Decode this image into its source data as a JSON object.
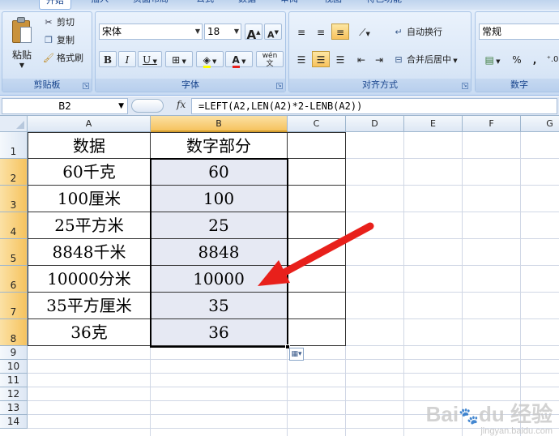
{
  "ribbon": {
    "tabs": [
      "开始",
      "插入",
      "页面布局",
      "公式",
      "数据",
      "审阅",
      "视图",
      "特色功能"
    ],
    "clipboard": {
      "paste": "粘贴",
      "cut": "剪切",
      "copy": "复制",
      "format_painter": "格式刷",
      "label": "剪贴板"
    },
    "font": {
      "name": "宋体",
      "size": "18",
      "grow": "A",
      "shrink": "A",
      "bold": "B",
      "italic": "I",
      "underline": "U",
      "wen": "wén",
      "label": "字体"
    },
    "align": {
      "wrap": "自动换行",
      "merge": "合并后居中",
      "label": "对齐方式"
    },
    "number": {
      "format": "常规",
      "percent": "%",
      "comma": ",",
      "label": "数字"
    }
  },
  "formula_bar": {
    "name_box": "B2",
    "fx": "fx",
    "formula": "=LEFT(A2,LEN(A2)*2-LENB(A2))"
  },
  "sheet": {
    "columns": [
      "A",
      "B",
      "C",
      "D",
      "E",
      "F",
      "G"
    ],
    "rows": [
      "1",
      "2",
      "3",
      "4",
      "5",
      "6",
      "7",
      "8",
      "9",
      "10",
      "11",
      "12",
      "13",
      "14"
    ],
    "header": [
      "数据",
      "数字部分"
    ],
    "data": [
      [
        "60千克",
        "60"
      ],
      [
        "100厘米",
        "100"
      ],
      [
        "25平方米",
        "25"
      ],
      [
        "8848千米",
        "8848"
      ],
      [
        "10000分米",
        "10000"
      ],
      [
        "35平方厘米",
        "35"
      ],
      [
        "36克",
        "36"
      ]
    ]
  },
  "watermark": {
    "brand": "Baidu经验",
    "url": "jingyan.baidu.com"
  },
  "colors": {
    "arrow": "#e8201b",
    "selection_fill": "#e6e9f3",
    "header_selected": "#f6c35e"
  }
}
